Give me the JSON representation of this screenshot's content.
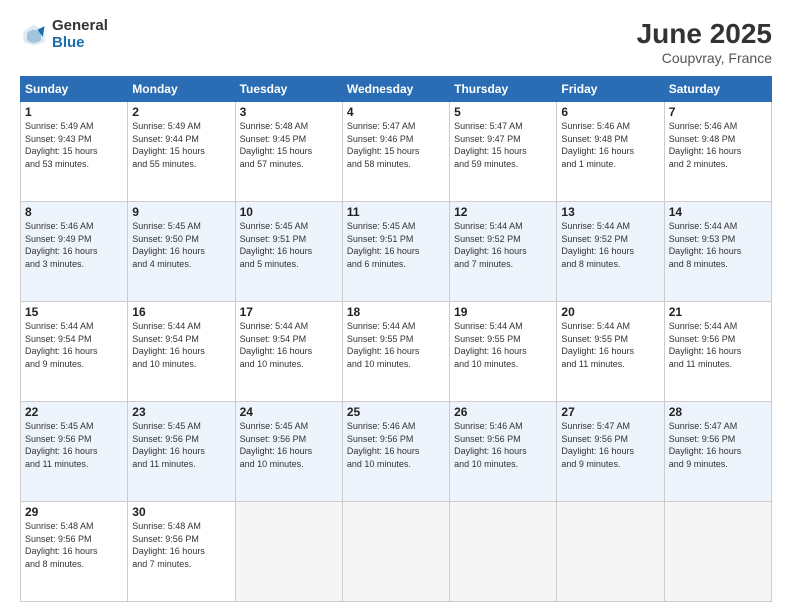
{
  "header": {
    "logo_general": "General",
    "logo_blue": "Blue",
    "month_year": "June 2025",
    "location": "Coupvray, France"
  },
  "days_of_week": [
    "Sunday",
    "Monday",
    "Tuesday",
    "Wednesday",
    "Thursday",
    "Friday",
    "Saturday"
  ],
  "weeks": [
    [
      {
        "day": 1,
        "lines": [
          "Sunrise: 5:49 AM",
          "Sunset: 9:43 PM",
          "Daylight: 15 hours",
          "and 53 minutes."
        ]
      },
      {
        "day": 2,
        "lines": [
          "Sunrise: 5:49 AM",
          "Sunset: 9:44 PM",
          "Daylight: 15 hours",
          "and 55 minutes."
        ]
      },
      {
        "day": 3,
        "lines": [
          "Sunrise: 5:48 AM",
          "Sunset: 9:45 PM",
          "Daylight: 15 hours",
          "and 57 minutes."
        ]
      },
      {
        "day": 4,
        "lines": [
          "Sunrise: 5:47 AM",
          "Sunset: 9:46 PM",
          "Daylight: 15 hours",
          "and 58 minutes."
        ]
      },
      {
        "day": 5,
        "lines": [
          "Sunrise: 5:47 AM",
          "Sunset: 9:47 PM",
          "Daylight: 15 hours",
          "and 59 minutes."
        ]
      },
      {
        "day": 6,
        "lines": [
          "Sunrise: 5:46 AM",
          "Sunset: 9:48 PM",
          "Daylight: 16 hours",
          "and 1 minute."
        ]
      },
      {
        "day": 7,
        "lines": [
          "Sunrise: 5:46 AM",
          "Sunset: 9:48 PM",
          "Daylight: 16 hours",
          "and 2 minutes."
        ]
      }
    ],
    [
      {
        "day": 8,
        "lines": [
          "Sunrise: 5:46 AM",
          "Sunset: 9:49 PM",
          "Daylight: 16 hours",
          "and 3 minutes."
        ]
      },
      {
        "day": 9,
        "lines": [
          "Sunrise: 5:45 AM",
          "Sunset: 9:50 PM",
          "Daylight: 16 hours",
          "and 4 minutes."
        ]
      },
      {
        "day": 10,
        "lines": [
          "Sunrise: 5:45 AM",
          "Sunset: 9:51 PM",
          "Daylight: 16 hours",
          "and 5 minutes."
        ]
      },
      {
        "day": 11,
        "lines": [
          "Sunrise: 5:45 AM",
          "Sunset: 9:51 PM",
          "Daylight: 16 hours",
          "and 6 minutes."
        ]
      },
      {
        "day": 12,
        "lines": [
          "Sunrise: 5:44 AM",
          "Sunset: 9:52 PM",
          "Daylight: 16 hours",
          "and 7 minutes."
        ]
      },
      {
        "day": 13,
        "lines": [
          "Sunrise: 5:44 AM",
          "Sunset: 9:52 PM",
          "Daylight: 16 hours",
          "and 8 minutes."
        ]
      },
      {
        "day": 14,
        "lines": [
          "Sunrise: 5:44 AM",
          "Sunset: 9:53 PM",
          "Daylight: 16 hours",
          "and 8 minutes."
        ]
      }
    ],
    [
      {
        "day": 15,
        "lines": [
          "Sunrise: 5:44 AM",
          "Sunset: 9:54 PM",
          "Daylight: 16 hours",
          "and 9 minutes."
        ]
      },
      {
        "day": 16,
        "lines": [
          "Sunrise: 5:44 AM",
          "Sunset: 9:54 PM",
          "Daylight: 16 hours",
          "and 10 minutes."
        ]
      },
      {
        "day": 17,
        "lines": [
          "Sunrise: 5:44 AM",
          "Sunset: 9:54 PM",
          "Daylight: 16 hours",
          "and 10 minutes."
        ]
      },
      {
        "day": 18,
        "lines": [
          "Sunrise: 5:44 AM",
          "Sunset: 9:55 PM",
          "Daylight: 16 hours",
          "and 10 minutes."
        ]
      },
      {
        "day": 19,
        "lines": [
          "Sunrise: 5:44 AM",
          "Sunset: 9:55 PM",
          "Daylight: 16 hours",
          "and 10 minutes."
        ]
      },
      {
        "day": 20,
        "lines": [
          "Sunrise: 5:44 AM",
          "Sunset: 9:55 PM",
          "Daylight: 16 hours",
          "and 11 minutes."
        ]
      },
      {
        "day": 21,
        "lines": [
          "Sunrise: 5:44 AM",
          "Sunset: 9:56 PM",
          "Daylight: 16 hours",
          "and 11 minutes."
        ]
      }
    ],
    [
      {
        "day": 22,
        "lines": [
          "Sunrise: 5:45 AM",
          "Sunset: 9:56 PM",
          "Daylight: 16 hours",
          "and 11 minutes."
        ]
      },
      {
        "day": 23,
        "lines": [
          "Sunrise: 5:45 AM",
          "Sunset: 9:56 PM",
          "Daylight: 16 hours",
          "and 11 minutes."
        ]
      },
      {
        "day": 24,
        "lines": [
          "Sunrise: 5:45 AM",
          "Sunset: 9:56 PM",
          "Daylight: 16 hours",
          "and 10 minutes."
        ]
      },
      {
        "day": 25,
        "lines": [
          "Sunrise: 5:46 AM",
          "Sunset: 9:56 PM",
          "Daylight: 16 hours",
          "and 10 minutes."
        ]
      },
      {
        "day": 26,
        "lines": [
          "Sunrise: 5:46 AM",
          "Sunset: 9:56 PM",
          "Daylight: 16 hours",
          "and 10 minutes."
        ]
      },
      {
        "day": 27,
        "lines": [
          "Sunrise: 5:47 AM",
          "Sunset: 9:56 PM",
          "Daylight: 16 hours",
          "and 9 minutes."
        ]
      },
      {
        "day": 28,
        "lines": [
          "Sunrise: 5:47 AM",
          "Sunset: 9:56 PM",
          "Daylight: 16 hours",
          "and 9 minutes."
        ]
      }
    ],
    [
      {
        "day": 29,
        "lines": [
          "Sunrise: 5:48 AM",
          "Sunset: 9:56 PM",
          "Daylight: 16 hours",
          "and 8 minutes."
        ]
      },
      {
        "day": 30,
        "lines": [
          "Sunrise: 5:48 AM",
          "Sunset: 9:56 PM",
          "Daylight: 16 hours",
          "and 7 minutes."
        ]
      },
      null,
      null,
      null,
      null,
      null
    ]
  ]
}
